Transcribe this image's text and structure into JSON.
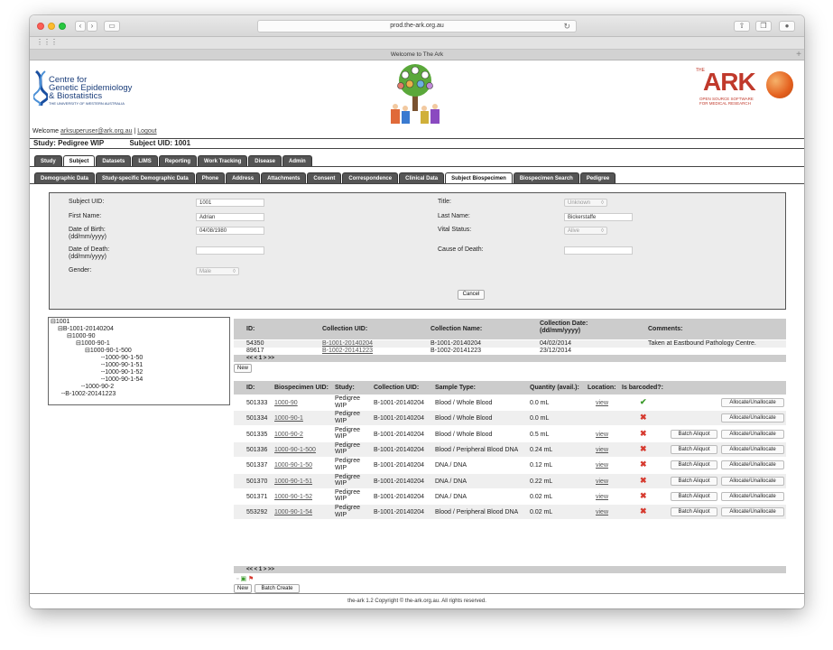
{
  "browser": {
    "url": "prod.the-ark.org.au",
    "tab_title": "Welcome to The Ark"
  },
  "header": {
    "org_name_lines": [
      "Centre for",
      "Genetic Epidemiology",
      "& Biostatistics"
    ],
    "org_sub": "THE UNIVERSITY OF WESTERN AUSTRALIA",
    "ark_the": "THE",
    "ark_word": "ARK",
    "ark_tagline_1": "OPEN SOURCE SOFTWARE",
    "ark_tagline_2": "FOR MEDICAL RESEARCH"
  },
  "welcome": {
    "prefix": "Welcome",
    "user": "arksuperuser@ark.org.au",
    "sep": "|",
    "logout": "Logout"
  },
  "study": {
    "study_label": "Study: Pedigree WIP",
    "subject_label": "Subject UID: 1001"
  },
  "main_tabs": [
    "Study",
    "Subject",
    "Datasets",
    "LIMS",
    "Reporting",
    "Work Tracking",
    "Disease",
    "Admin"
  ],
  "main_tab_active": "Subject",
  "sub_tabs": [
    "Demographic Data",
    "Study-specific Demographic Data",
    "Phone",
    "Address",
    "Attachments",
    "Consent",
    "Correspondence",
    "Clinical Data",
    "Subject Biospecimen",
    "Biospecimen Search",
    "Pedigree"
  ],
  "sub_tab_active": "Subject Biospecimen",
  "subject_form": {
    "subject_uid_label": "Subject UID:",
    "subject_uid_value": "1001",
    "first_name_label": "First Name:",
    "first_name_value": "Adrian",
    "dob_label_1": "Date of Birth:",
    "dob_label_2": "(dd/mm/yyyy)",
    "dob_value": "04/08/1980",
    "dod_label_1": "Date of Death:",
    "dod_label_2": "(dd/mm/yyyy)",
    "dod_value": "",
    "gender_label": "Gender:",
    "gender_value": "Male",
    "title_label": "Title:",
    "title_value": "Unknown",
    "last_name_label": "Last Name:",
    "last_name_value": "Bickerstaffe",
    "vital_status_label": "Vital Status:",
    "vital_status_value": "Alive",
    "cause_label": "Cause of Death:",
    "cause_value": "",
    "cancel_label": "Cancel"
  },
  "tree": {
    "nodes": [
      "1001",
      "B-1001-20140204",
      "1000-90",
      "1000-90-1",
      "1000-90-1-500",
      "1000-90-1-50",
      "1000-90-1-51",
      "1000-90-1-52",
      "1000-90-1-54",
      "1000-90-2",
      "B-1002-20141223"
    ]
  },
  "collections": {
    "headers": {
      "id": "ID:",
      "uid": "Collection UID:",
      "name": "Collection Name:",
      "date_1": "Collection Date:",
      "date_2": "(dd/mm/yyyy)",
      "comments": "Comments:"
    },
    "rows": [
      {
        "id": "54350",
        "uid": "B-1001-20140204",
        "name": "B-1001-20140204",
        "date": "04/02/2014",
        "comments": "Taken at Eastbound Pathology Centre."
      },
      {
        "id": "89617",
        "uid": "B-1002-20141223",
        "name": "B-1002-20141223",
        "date": "23/12/2014",
        "comments": ""
      }
    ],
    "pager": "<< < 1 > >>",
    "new_label": "New"
  },
  "biospecimens": {
    "headers": {
      "id": "ID:",
      "uid": "Biospecimen UID:",
      "study": "Study:",
      "collection": "Collection UID:",
      "sample": "Sample Type:",
      "qty": "Quantity (avail.):",
      "location": "Location:",
      "barcoded": "Is barcoded?:"
    },
    "rows": [
      {
        "id": "501333",
        "uid": "1000-90",
        "study_1": "Pedigree",
        "study_2": "WIP",
        "collection": "B-1001-20140204",
        "sample": "Blood / Whole Blood",
        "qty": "0.0 mL",
        "location": "view",
        "barcoded": "yes",
        "batch": "",
        "allocate": "Allocate/Unallocate"
      },
      {
        "id": "501334",
        "uid": "1000-90-1",
        "study_1": "Pedigree",
        "study_2": "WIP",
        "collection": "B-1001-20140204",
        "sample": "Blood / Whole Blood",
        "qty": "0.0 mL",
        "location": "",
        "barcoded": "no",
        "batch": "",
        "allocate": "Allocate/Unallocate"
      },
      {
        "id": "501335",
        "uid": "1000-90-2",
        "study_1": "Pedigree",
        "study_2": "WIP",
        "collection": "B-1001-20140204",
        "sample": "Blood / Whole Blood",
        "qty": "0.5 mL",
        "location": "view",
        "barcoded": "no",
        "batch": "Batch Aliquot",
        "allocate": "Allocate/Unallocate"
      },
      {
        "id": "501336",
        "uid": "1000-90-1-500",
        "study_1": "Pedigree",
        "study_2": "WIP",
        "collection": "B-1001-20140204",
        "sample": "Blood / Peripheral Blood DNA",
        "qty": "0.24 mL",
        "location": "view",
        "barcoded": "no",
        "batch": "Batch Aliquot",
        "allocate": "Allocate/Unallocate"
      },
      {
        "id": "501337",
        "uid": "1000-90-1-50",
        "study_1": "Pedigree",
        "study_2": "WIP",
        "collection": "B-1001-20140204",
        "sample": "DNA / DNA",
        "qty": "0.12 mL",
        "location": "view",
        "barcoded": "no",
        "batch": "Batch Aliquot",
        "allocate": "Allocate/Unallocate"
      },
      {
        "id": "501370",
        "uid": "1000-90-1-51",
        "study_1": "Pedigree",
        "study_2": "WIP",
        "collection": "B-1001-20140204",
        "sample": "DNA / DNA",
        "qty": "0.22 mL",
        "location": "view",
        "barcoded": "no",
        "batch": "Batch Aliquot",
        "allocate": "Allocate/Unallocate"
      },
      {
        "id": "501371",
        "uid": "1000-90-1-52",
        "study_1": "Pedigree",
        "study_2": "WIP",
        "collection": "B-1001-20140204",
        "sample": "DNA / DNA",
        "qty": "0.02 mL",
        "location": "view",
        "barcoded": "no",
        "batch": "Batch Aliquot",
        "allocate": "Allocate/Unallocate"
      },
      {
        "id": "553292",
        "uid": "1000-90-1-54",
        "study_1": "Pedigree",
        "study_2": "WIP",
        "collection": "B-1001-20140204",
        "sample": "Blood / Peripheral Blood DNA",
        "qty": "0.02 mL",
        "location": "view",
        "barcoded": "no",
        "batch": "Batch Aliquot",
        "allocate": "Allocate/Unallocate"
      }
    ],
    "pager": "<< < 1 > >>",
    "new_label": "New",
    "batch_create_label": "Batch Create"
  },
  "footer": {
    "text": "the-ark 1.2 Copyright © the-ark.org.au. All rights reserved."
  },
  "colors": {
    "tab_dark": "#555555",
    "accent_red": "#c0392b",
    "brand_blue": "#1a3d7a",
    "ok_green": "#3b9a2b",
    "error_red": "#d63a2f"
  }
}
